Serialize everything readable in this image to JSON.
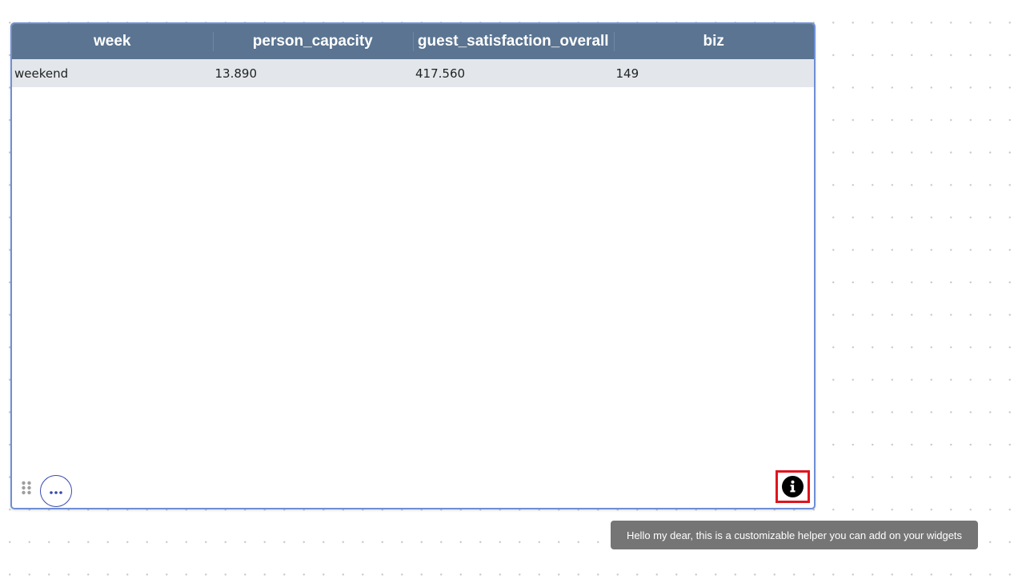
{
  "table": {
    "columns": [
      "week",
      "person_capacity",
      "guest_satisfaction_overall",
      "biz"
    ],
    "rows": [
      [
        "weekend",
        "13.890",
        "417.560",
        "149"
      ]
    ]
  },
  "icons": {
    "drag": "drag-handle-icon",
    "more": "more-horizontal-icon",
    "info": "info-icon"
  },
  "tooltip": {
    "text": "Hello my dear, this is a customizable helper you can add on your widgets"
  },
  "colors": {
    "header_bg": "#5a7491",
    "row_bg": "#e3e7eb",
    "widget_border": "#6f8fd6",
    "more_button_border": "#3949ab",
    "highlight": "#e0141e",
    "tooltip_bg": "#757575"
  }
}
